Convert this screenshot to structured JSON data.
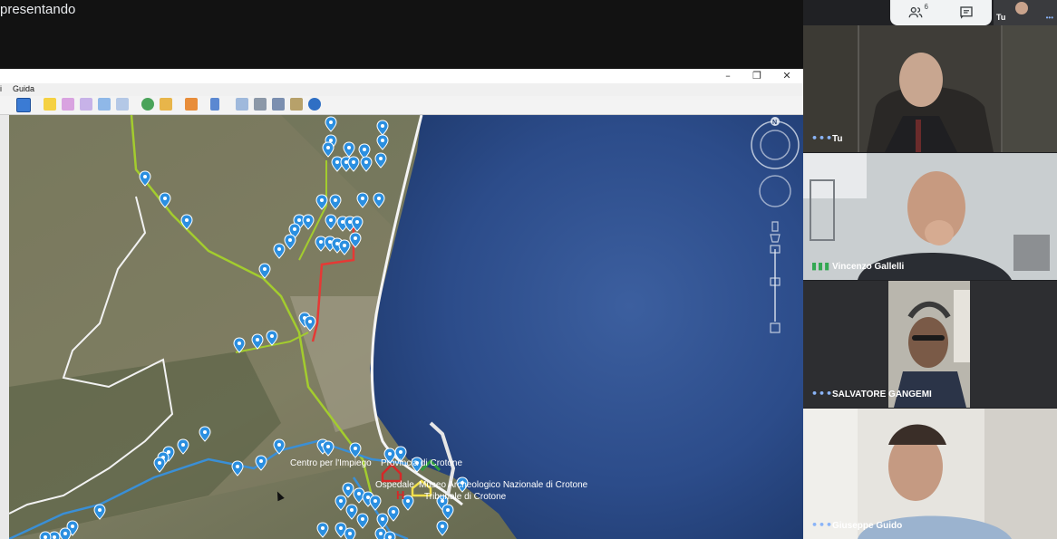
{
  "meeting": {
    "presenting_label": "presentando",
    "participants_badge": "6",
    "self_label": "Tu"
  },
  "app": {
    "menu": [
      "i",
      "Guida"
    ],
    "map_labels": {
      "compass": "N",
      "centro_impiego": "Centro per l'Impiego",
      "provincia": "Provincia di Crotone",
      "ospedale": "Ospedale",
      "museo": "Museo Archeologico Nazionale di Crotone",
      "tribunale": "Tribunale di Crotone"
    }
  },
  "participants": [
    {
      "name": "Tu",
      "mic": "dots"
    },
    {
      "name": "Vincenzo Gallelli",
      "mic": "speaking"
    },
    {
      "name": "SALVATORE GANGEMI",
      "mic": "dots"
    },
    {
      "name": "Giuseppe Guido",
      "mic": "dots"
    }
  ],
  "colors": {
    "meet_dark": "#202124",
    "accent_blue": "#8ab4f8",
    "speaking_green": "#34a853",
    "route_yellow": "#a3cc2e",
    "route_red": "#e53935",
    "route_blue": "#3a8fd6",
    "pin_blue": "#2b8fe0"
  }
}
